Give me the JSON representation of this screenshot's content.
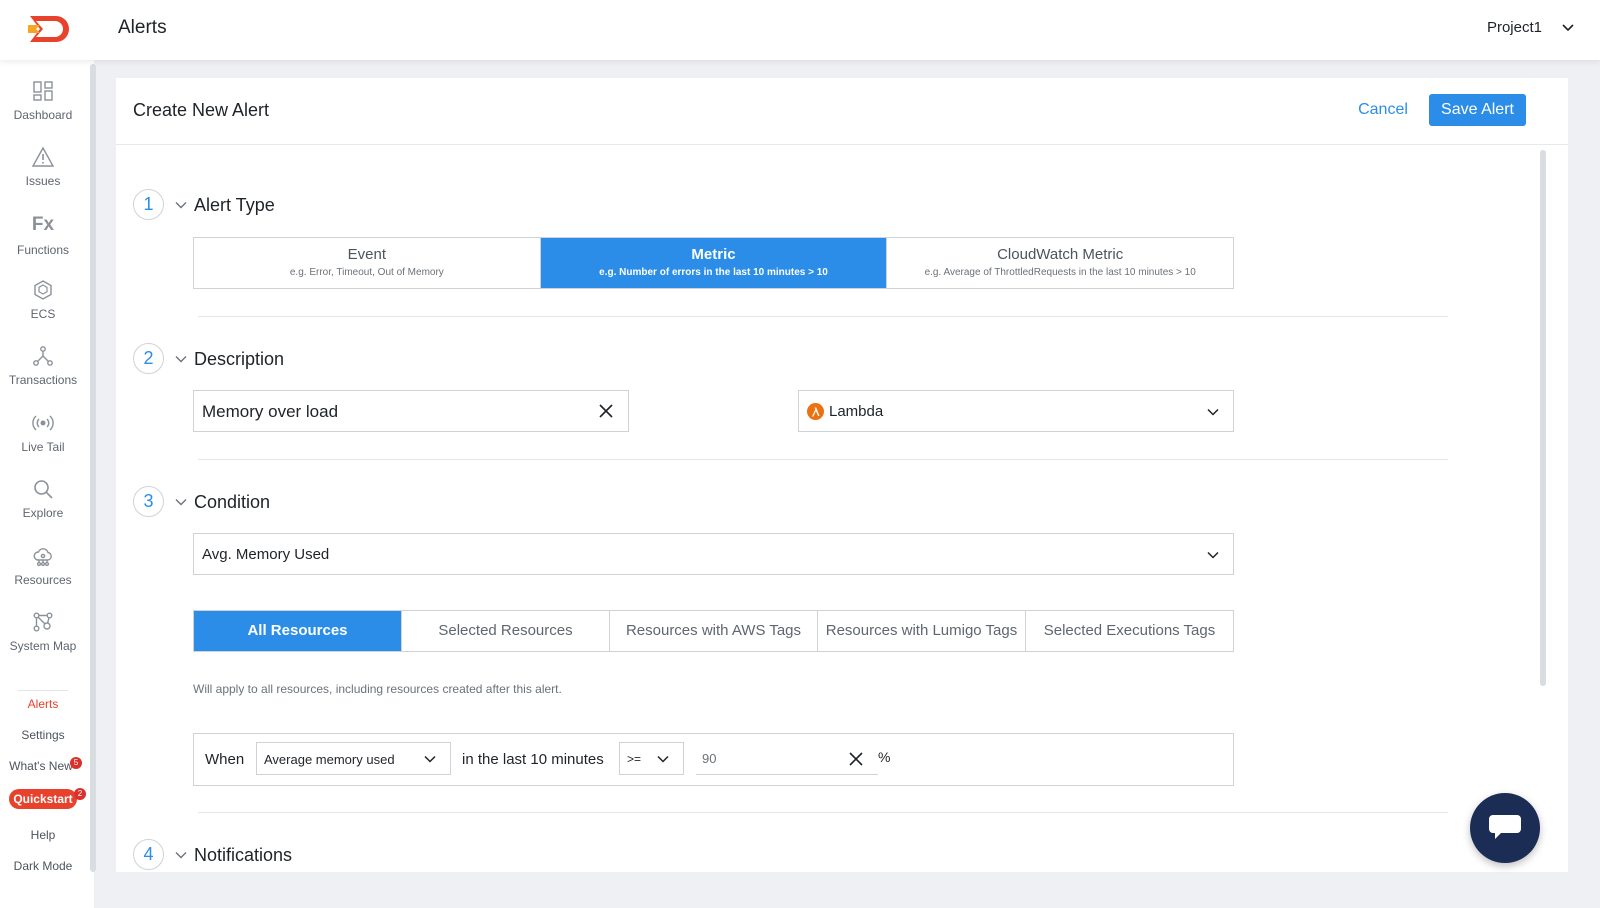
{
  "header": {
    "title": "Alerts",
    "project": "Project1"
  },
  "sidebar": {
    "items": [
      {
        "label": "Dashboard",
        "icon": "dashboard-icon"
      },
      {
        "label": "Issues",
        "icon": "warning-icon"
      },
      {
        "label": "Functions",
        "icon": "fx-icon",
        "glyph": "Fx"
      },
      {
        "label": "ECS",
        "icon": "ecs-icon"
      },
      {
        "label": "Transactions",
        "icon": "transactions-icon"
      },
      {
        "label": "Live Tail",
        "icon": "live-tail-icon"
      },
      {
        "label": "Explore",
        "icon": "search-icon"
      },
      {
        "label": "Resources",
        "icon": "resources-icon"
      },
      {
        "label": "System Map",
        "icon": "system-map-icon"
      }
    ],
    "lower": {
      "alerts": "Alerts",
      "settings": "Settings",
      "whats_new": "What's New",
      "whats_new_badge": "5",
      "quickstart": "Quickstart",
      "quickstart_badge": "2",
      "help": "Help",
      "dark_mode": "Dark Mode"
    },
    "accent": "#e8412c"
  },
  "form": {
    "title": "Create New Alert",
    "cancel": "Cancel",
    "save": "Save Alert",
    "accent": "#2b8de8",
    "steps": [
      {
        "number": "1",
        "title": "Alert Type"
      },
      {
        "number": "2",
        "title": "Description"
      },
      {
        "number": "3",
        "title": "Condition"
      },
      {
        "number": "4",
        "title": "Notifications"
      }
    ],
    "alert_types": [
      {
        "title": "Event",
        "example": "e.g. Error, Timeout, Out of Memory",
        "selected": false
      },
      {
        "title": "Metric",
        "example": "e.g. Number of errors in the last 10 minutes > 10",
        "selected": true
      },
      {
        "title": "CloudWatch Metric",
        "example": "e.g. Average of ThrottledRequests in the last 10 minutes > 10",
        "selected": false
      }
    ],
    "description": {
      "name_value": "Memory over load",
      "runtime_value": "Lambda"
    },
    "condition": {
      "metric_value": "Avg. Memory Used",
      "resource_tabs": [
        {
          "label": "All Resources",
          "selected": true
        },
        {
          "label": "Selected Resources",
          "selected": false
        },
        {
          "label": "Resources with AWS Tags",
          "selected": false
        },
        {
          "label": "Resources with Lumigo Tags",
          "selected": false
        },
        {
          "label": "Selected Executions Tags",
          "selected": false
        }
      ],
      "helper": "Will apply to all resources, including resources created after this alert.",
      "when_label": "When",
      "when_metric": "Average memory used",
      "window_text": "in the last 10 minutes",
      "operator": ">=",
      "threshold": "90",
      "unit": "%"
    }
  }
}
